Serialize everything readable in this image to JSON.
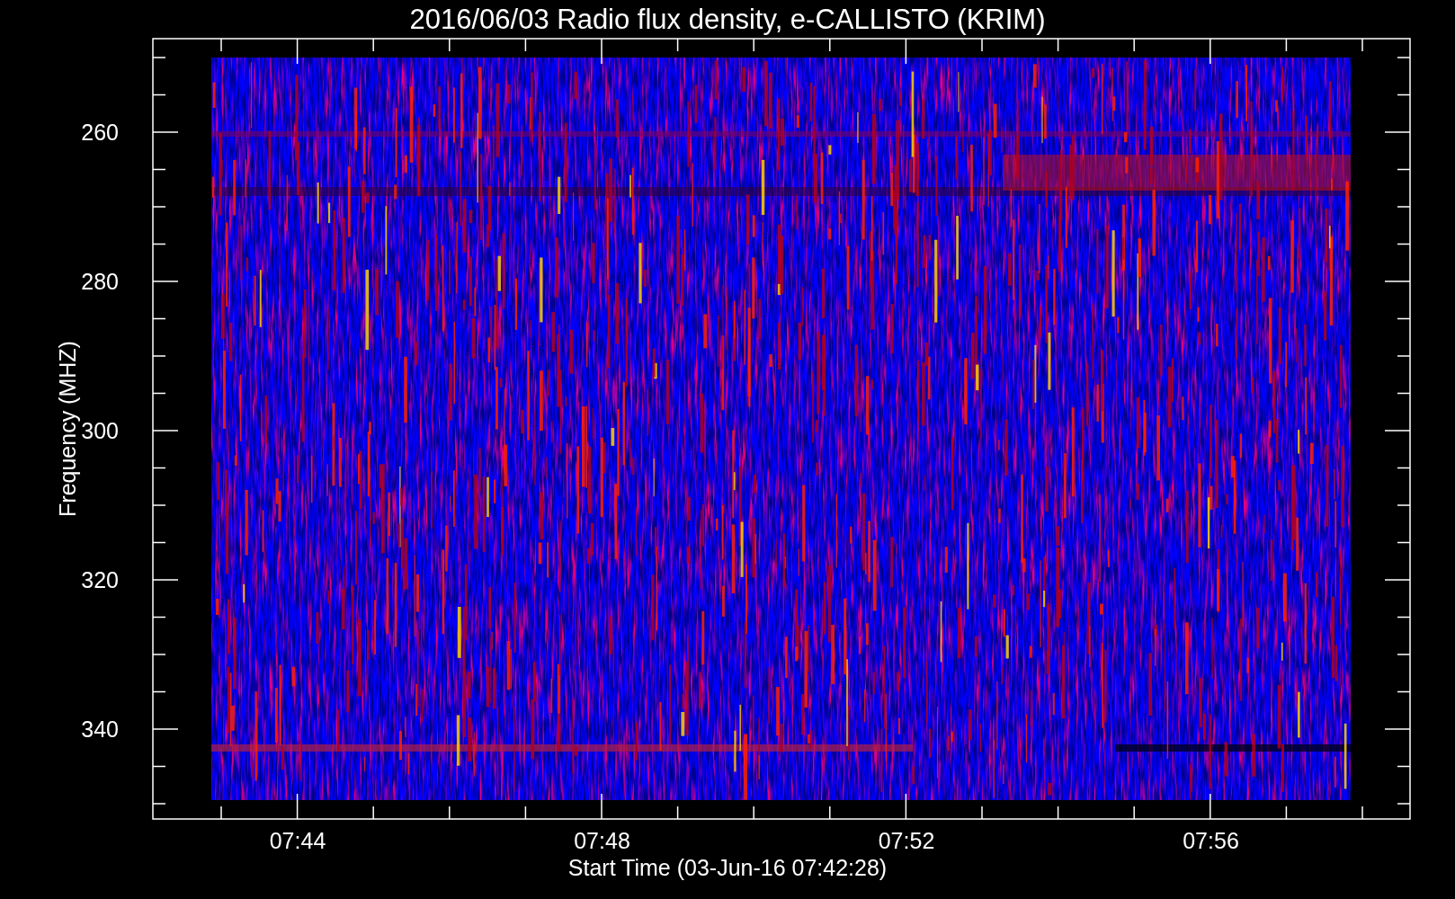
{
  "title": "2016/06/03  Radio flux density, e-CALLISTO (KRIM)",
  "y_axis": {
    "label": "Frequency (MHZ)",
    "ticks": [
      "260",
      "280",
      "300",
      "320",
      "340"
    ]
  },
  "x_axis": {
    "label": "Start Time (03-Jun-16 07:42:28)",
    "ticks": [
      "07:44",
      "07:48",
      "07:52",
      "07:56"
    ]
  }
}
